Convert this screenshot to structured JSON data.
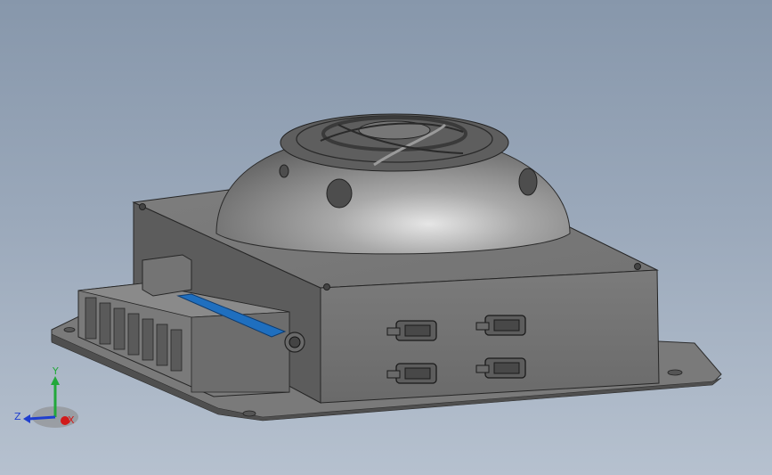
{
  "view": {
    "background_top": "#8797ab",
    "background_bottom": "#b6c1cf",
    "model_color": "#6e6e6e"
  },
  "triad": {
    "x_label": "X",
    "y_label": "Y",
    "z_label": "Z",
    "x_color": "#d11a1a",
    "y_color": "#22a83a",
    "z_color": "#1f3fcf"
  },
  "model": {
    "cable_color": "#1f6fbf",
    "connector_count": 4
  }
}
